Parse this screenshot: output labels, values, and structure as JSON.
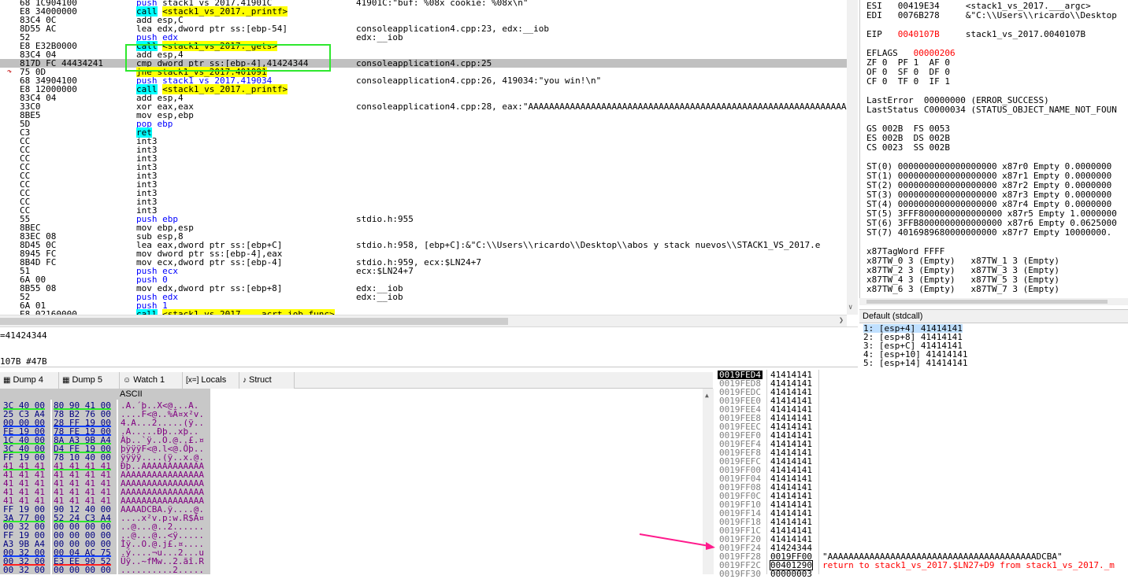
{
  "disasm": {
    "rows": [
      {
        "bytes": "68 1C904100",
        "instr": [
          [
            "push",
            "push"
          ],
          [
            " stack1_vs_2017.41901C",
            "fnc"
          ]
        ],
        "comment": "41901C:\"buf: %08x cookie: %08x\\n\""
      },
      {
        "bytes": "E8 34000000",
        "instr": [
          [
            "call",
            "callt"
          ],
          [
            " ",
            "fnc"
          ],
          [
            "<stack1_vs_2017._printf>",
            "callt"
          ]
        ],
        "comment": ""
      },
      {
        "bytes": "83C4 0C",
        "instr": [
          [
            "add esp,C",
            "fnc"
          ]
        ],
        "comment": ""
      },
      {
        "bytes": "8D55 AC",
        "instr": [
          [
            "lea edx,dword ptr ss:[ebp-54]",
            "fnc"
          ]
        ],
        "comment": "consoleapplication4.cpp:23, edx:__iob"
      },
      {
        "bytes": "52",
        "instr": [
          [
            "push edx",
            "push"
          ]
        ],
        "comment": "edx:__iob"
      },
      {
        "bytes": "E8 E32B0000",
        "instr": [
          [
            "call",
            "callt"
          ],
          [
            " ",
            "fnc"
          ],
          [
            "<stack1_vs_2017._gets>",
            "callt"
          ]
        ],
        "comment": ""
      },
      {
        "bytes": "83C4 04",
        "instr": [
          [
            "add esp,4",
            "fnc"
          ]
        ],
        "comment": ""
      },
      {
        "bytes": "817D FC 44434241",
        "instr": [
          [
            "cmp dword ptr ss:[ebp-4],41424344",
            "fnc"
          ]
        ],
        "comment": "consoleapplication4.cpp:25"
      },
      {
        "bytes": "75 0D",
        "instr": [
          [
            "jne stack1_vs_2017.401091",
            "jne"
          ]
        ],
        "comment": ""
      },
      {
        "bytes": "68 34904100",
        "instr": [
          [
            "push stack1_vs_2017.419034",
            "push"
          ]
        ],
        "comment": "consoleapplication4.cpp:26, 419034:\"you win!\\n\""
      },
      {
        "bytes": "E8 12000000",
        "instr": [
          [
            "call",
            "callt"
          ],
          [
            " ",
            "fnc"
          ],
          [
            "<stack1_vs_2017._printf>",
            "callt"
          ]
        ],
        "comment": ""
      },
      {
        "bytes": "83C4 04",
        "instr": [
          [
            "add esp,4",
            "fnc"
          ]
        ],
        "comment": ""
      },
      {
        "bytes": "33C0",
        "instr": [
          [
            "xor eax,eax",
            "fnc"
          ]
        ],
        "comment": "consoleapplication4.cpp:28, eax:\"AAAAAAAAAAAAAAAAAAAAAAAAAAAAAAAAAAAAAAAAAAAAAAAAAAAAAAAAAAAAAAAAAAAAAA"
      },
      {
        "bytes": "8BE5",
        "instr": [
          [
            "mov esp,ebp",
            "fnc"
          ]
        ],
        "comment": ""
      },
      {
        "bytes": "5D",
        "instr": [
          [
            "pop ebp",
            "push"
          ]
        ],
        "comment": ""
      },
      {
        "bytes": "C3",
        "instr": [
          [
            "ret",
            "ret"
          ]
        ],
        "comment": ""
      },
      {
        "bytes": "CC",
        "instr": [
          [
            "int3",
            "fnc"
          ]
        ],
        "comment": ""
      },
      {
        "bytes": "CC",
        "instr": [
          [
            "int3",
            "fnc"
          ]
        ],
        "comment": ""
      },
      {
        "bytes": "CC",
        "instr": [
          [
            "int3",
            "fnc"
          ]
        ],
        "comment": ""
      },
      {
        "bytes": "CC",
        "instr": [
          [
            "int3",
            "fnc"
          ]
        ],
        "comment": ""
      },
      {
        "bytes": "CC",
        "instr": [
          [
            "int3",
            "fnc"
          ]
        ],
        "comment": ""
      },
      {
        "bytes": "CC",
        "instr": [
          [
            "int3",
            "fnc"
          ]
        ],
        "comment": ""
      },
      {
        "bytes": "CC",
        "instr": [
          [
            "int3",
            "fnc"
          ]
        ],
        "comment": ""
      },
      {
        "bytes": "CC",
        "instr": [
          [
            "int3",
            "fnc"
          ]
        ],
        "comment": ""
      },
      {
        "bytes": "CC",
        "instr": [
          [
            "int3",
            "fnc"
          ]
        ],
        "comment": ""
      },
      {
        "bytes": "55",
        "instr": [
          [
            "push ebp",
            "push"
          ]
        ],
        "comment": "stdio.h:955"
      },
      {
        "bytes": "8BEC",
        "instr": [
          [
            "mov ebp,esp",
            "fnc"
          ]
        ],
        "comment": ""
      },
      {
        "bytes": "83EC 08",
        "instr": [
          [
            "sub esp,8",
            "fnc"
          ]
        ],
        "comment": ""
      },
      {
        "bytes": "8D45 0C",
        "instr": [
          [
            "lea eax,dword ptr ss:[ebp+C]",
            "fnc"
          ]
        ],
        "comment": "stdio.h:958, [ebp+C]:&\"C:\\\\Users\\\\ricardo\\\\Desktop\\\\abos y stack nuevos\\\\STACK1_VS_2017.e"
      },
      {
        "bytes": "8945 FC",
        "instr": [
          [
            "mov dword ptr ss:[ebp-4],eax",
            "fnc"
          ]
        ],
        "comment": ""
      },
      {
        "bytes": "8B4D FC",
        "instr": [
          [
            "mov ecx,dword ptr ss:[ebp-4]",
            "fnc"
          ]
        ],
        "comment": "stdio.h:959, ecx:$LN24+7"
      },
      {
        "bytes": "51",
        "instr": [
          [
            "push ecx",
            "push"
          ]
        ],
        "comment": "ecx:$LN24+7"
      },
      {
        "bytes": "6A 00",
        "instr": [
          [
            "push 0",
            "push"
          ]
        ],
        "comment": ""
      },
      {
        "bytes": "8B55 08",
        "instr": [
          [
            "mov edx,dword ptr ss:[ebp+8]",
            "fnc"
          ]
        ],
        "comment": "edx:__iob"
      },
      {
        "bytes": "52",
        "instr": [
          [
            "push edx",
            "push"
          ]
        ],
        "comment": "edx:__iob"
      },
      {
        "bytes": "6A 01",
        "instr": [
          [
            "push 1",
            "push"
          ]
        ],
        "comment": ""
      },
      {
        "bytes": "E8 02160000",
        "instr": [
          [
            "call",
            "callt"
          ],
          [
            " ",
            "fnc"
          ],
          [
            "<stack1_vs_2017.___acrt_iob_func>",
            "callt"
          ]
        ],
        "comment": ""
      }
    ],
    "selected_index": 7,
    "arrow_index": 8,
    "arrow_glyph": "↷"
  },
  "info": {
    "line1": "=41424344",
    "line2": "107B #47B"
  },
  "registers": {
    "lines": [
      {
        "t": "ESI   00419E34     <stack1_vs_2017.___argc>"
      },
      {
        "t": "EDI   0076B278     &\"C:\\\\Users\\\\ricardo\\\\Desktop"
      },
      {
        "t": ""
      },
      {
        "t": "EIP   ",
        "red": "0040107B",
        "rest": "     stack1_vs_2017.0040107B"
      },
      {
        "t": ""
      },
      {
        "t": "EFLAGS   ",
        "red": "00000206",
        "rest": ""
      },
      {
        "t": "ZF 0  PF 1  AF 0"
      },
      {
        "t": "OF 0  SF 0  DF 0"
      },
      {
        "t": "CF 0  TF 0  IF 1"
      },
      {
        "t": ""
      },
      {
        "t": "LastError  00000000 (ERROR_SUCCESS)"
      },
      {
        "t": "LastStatus C0000034 (STATUS_OBJECT_NAME_NOT_FOUN"
      },
      {
        "t": ""
      },
      {
        "t": "GS 002B  FS 0053"
      },
      {
        "t": "ES 002B  DS 002B"
      },
      {
        "t": "CS 0023  SS 002B"
      },
      {
        "t": ""
      },
      {
        "t": "ST(0) 0000000000000000000 x87r0 Empty 0.0000000"
      },
      {
        "t": "ST(1) 0000000000000000000 x87r1 Empty 0.0000000"
      },
      {
        "t": "ST(2) 0000000000000000000 x87r2 Empty 0.0000000"
      },
      {
        "t": "ST(3) 0000000000000000000 x87r3 Empty 0.0000000"
      },
      {
        "t": "ST(4) 0000000000000000000 x87r4 Empty 0.0000000"
      },
      {
        "t": "ST(5) 3FFF8000000000000000 x87r5 Empty 1.0000000"
      },
      {
        "t": "ST(6) 3FFB8000000000000000 x87r6 Empty 0.0625000"
      },
      {
        "t": "ST(7) 4016989680000000000 x87r7 Empty 10000000."
      },
      {
        "t": ""
      },
      {
        "t": "x87TagWord FFFF"
      },
      {
        "t": "x87TW_0 3 (Empty)   x87TW_1 3 (Empty)"
      },
      {
        "t": "x87TW_2 3 (Empty)   x87TW_3 3 (Empty)"
      },
      {
        "t": "x87TW_4 3 (Empty)   x87TW_5 3 (Empty)"
      },
      {
        "t": "x87TW_6 3 (Empty)   x87TW_7 3 (Empty)"
      }
    ]
  },
  "args": {
    "title": "Default (stdcall)",
    "lines": [
      "1: [esp+4] 41414141",
      "2: [esp+8] 41414141",
      "3: [esp+C] 41414141",
      "4: [esp+10] 41414141",
      "5: [esp+14] 41414141"
    ]
  },
  "tabs": [
    {
      "label": "Dump 4",
      "icon": "▦"
    },
    {
      "label": "Dump 5",
      "icon": "▦"
    },
    {
      "label": "Watch 1",
      "icon": "☺"
    },
    {
      "label": "Locals",
      "icon": "[x=]"
    },
    {
      "label": "Struct",
      "icon": "♪"
    }
  ],
  "dump": {
    "ascii_header": "ASCII",
    "rows": [
      {
        "h1": "3C 40 00",
        "h2": "80 90 41 00",
        "a": ".A.´þ..X<@...A."
      },
      {
        "h1": "25 C3 A4",
        "h2": "78 B2 76 00",
        "a": "....F<@..%Ã¤x²v."
      },
      {
        "h1": "00 00 00",
        "h2": "28 FF 19 00",
        "a": "4.A...2.....(ÿ.."
      },
      {
        "h1": "FE 19 00",
        "h2": "78 FE 19 00",
        "a": ".A.....Ðþ..xþ.."
      },
      {
        "h1": "1C 40 00",
        "h2": "8A A3 9B A4",
        "a": "Àþ..`ÿ..O.@..£.¤"
      },
      {
        "h1": "3C 40 00",
        "h2": "D4 FE 19 00",
        "a": "þÿÿÿF<@.l<@.Ôþ.."
      },
      {
        "h1": "FF 19 00",
        "h2": "78 10 40 00",
        "a": "ÿÿÿÿ....(ÿ..x.@."
      },
      {
        "h1": "41 41 41",
        "h2": "41 41 41 41",
        "a": "Ðþ..AAAAAAAAAAAA"
      },
      {
        "h1": "41 41 41",
        "h2": "41 41 41 41",
        "a": "AAAAAAAAAAAAAAAA"
      },
      {
        "h1": "41 41 41",
        "h2": "41 41 41 41",
        "a": "AAAAAAAAAAAAAAAA"
      },
      {
        "h1": "41 41 41",
        "h2": "41 41 41 41",
        "a": "AAAAAAAAAAAAAAAA"
      },
      {
        "h1": "41 41 41",
        "h2": "41 41 41 41",
        "a": "AAAAAAAAAAAAAAAA"
      },
      {
        "h1": "FF 19 00",
        "h2": "90 12 40 00",
        "a": "AAAADCBA.ÿ....@."
      },
      {
        "h1": "3A 77 00",
        "h2": "52 24 C3 A4",
        "a": "....x²v.p:w.R$Ã¤"
      },
      {
        "h1": "00 32 00",
        "h2": "00 00 00 00",
        "a": "..@...@..2......"
      },
      {
        "h1": "FF 19 00",
        "h2": "00 00 00 00",
        "a": "..@...@..<ÿ....."
      },
      {
        "h1": "A3 9B A4",
        "h2": "00 00 00 00",
        "a": "Ìÿ..O.@.j£.¤...."
      },
      {
        "h1": "00 32 00",
        "h2": "00 04 AC 75",
        "a": ".ý....¬u...2...u"
      },
      {
        "h1": "00 32 00",
        "h2": "E3 EE 90 52",
        "a": "Üÿ..~fMw..2.ãî.R"
      },
      {
        "h1": "00 32 00",
        "h2": "00 00 00 00",
        "a": "..........2....."
      }
    ]
  },
  "stack": {
    "rows": [
      {
        "addr": "0019FED4",
        "val": "41414141",
        "comm": ""
      },
      {
        "addr": "0019FED8",
        "val": "41414141",
        "comm": ""
      },
      {
        "addr": "0019FEDC",
        "val": "41414141",
        "comm": ""
      },
      {
        "addr": "0019FEE0",
        "val": "41414141",
        "comm": ""
      },
      {
        "addr": "0019FEE4",
        "val": "41414141",
        "comm": ""
      },
      {
        "addr": "0019FEE8",
        "val": "41414141",
        "comm": ""
      },
      {
        "addr": "0019FEEC",
        "val": "41414141",
        "comm": ""
      },
      {
        "addr": "0019FEF0",
        "val": "41414141",
        "comm": ""
      },
      {
        "addr": "0019FEF4",
        "val": "41414141",
        "comm": ""
      },
      {
        "addr": "0019FEF8",
        "val": "41414141",
        "comm": ""
      },
      {
        "addr": "0019FEFC",
        "val": "41414141",
        "comm": ""
      },
      {
        "addr": "0019FF00",
        "val": "41414141",
        "comm": ""
      },
      {
        "addr": "0019FF04",
        "val": "41414141",
        "comm": ""
      },
      {
        "addr": "0019FF08",
        "val": "41414141",
        "comm": ""
      },
      {
        "addr": "0019FF0C",
        "val": "41414141",
        "comm": ""
      },
      {
        "addr": "0019FF10",
        "val": "41414141",
        "comm": ""
      },
      {
        "addr": "0019FF14",
        "val": "41414141",
        "comm": ""
      },
      {
        "addr": "0019FF18",
        "val": "41414141",
        "comm": ""
      },
      {
        "addr": "0019FF1C",
        "val": "41414141",
        "comm": ""
      },
      {
        "addr": "0019FF20",
        "val": "41414141",
        "comm": ""
      },
      {
        "addr": "0019FF24",
        "val": "41424344",
        "comm": ""
      },
      {
        "addr": "0019FF28",
        "val": "0019FF00",
        "comm": "\"AAAAAAAAAAAAAAAAAAAAAAAAAAAAAAAAAAAAAAAADCBA\""
      },
      {
        "addr": "0019FF2C",
        "val": "00401290",
        "comm": "return to stack1_vs_2017.$LN27+D9 from stack1_vs_2017._m",
        "ret": true
      },
      {
        "addr": "0019FF30",
        "val": "00000003",
        "comm": ""
      }
    ],
    "selected_index": 0
  },
  "colors": {
    "highlight_box": "#2ee82e",
    "pointer_arrow": "#ff1a8c"
  }
}
